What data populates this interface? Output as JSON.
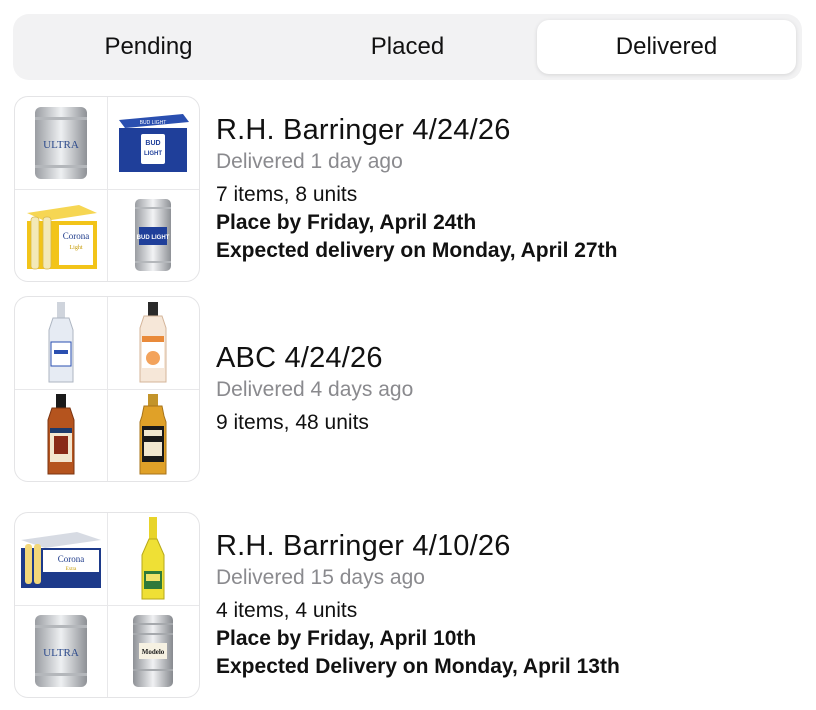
{
  "tabs": [
    {
      "label": "Pending"
    },
    {
      "label": "Placed"
    },
    {
      "label": "Delivered"
    }
  ],
  "active_tab": "Delivered",
  "orders": [
    {
      "title": "R.H. Barringer 4/24/26",
      "status": "Delivered 1 day ago",
      "summary": "7 items, 8 units",
      "place_by": "Place by Friday, April 24th",
      "expected": "Expected delivery on Monday, April 27th",
      "thumbnails": [
        "keg-ultra",
        "bud-light-case",
        "corona-light-case",
        "keg-bud-light"
      ],
      "thumb_labels": [
        "ULTRA",
        "BUD LIGHT",
        "Corona",
        "BUD LIGHT"
      ]
    },
    {
      "title": "ABC 4/24/26",
      "status": "Delivered 4 days ago",
      "summary": "9 items, 48 units",
      "thumbnails": [
        "clear-bottle",
        "peach-bottle",
        "rum-bottle",
        "bourbon-bottle"
      ]
    },
    {
      "title": "R.H. Barringer 4/10/26",
      "status": "Delivered 15 days ago",
      "summary": "4 items, 4 units",
      "place_by": "Place by Friday, April 10th",
      "expected": "Expected Delivery on Monday, April 13th",
      "thumbnails": [
        "corona-extra-case",
        "yellow-bottle",
        "keg-ultra",
        "keg-modelo"
      ],
      "thumb_labels": [
        "Corona",
        "ULTRA",
        "Modelo"
      ]
    }
  ],
  "colors": {
    "segment_bg": "#f2f2f3",
    "muted_text": "#8a8a8e",
    "bud_blue": "#1f3f9a",
    "corona_yellow": "#f2c419"
  }
}
